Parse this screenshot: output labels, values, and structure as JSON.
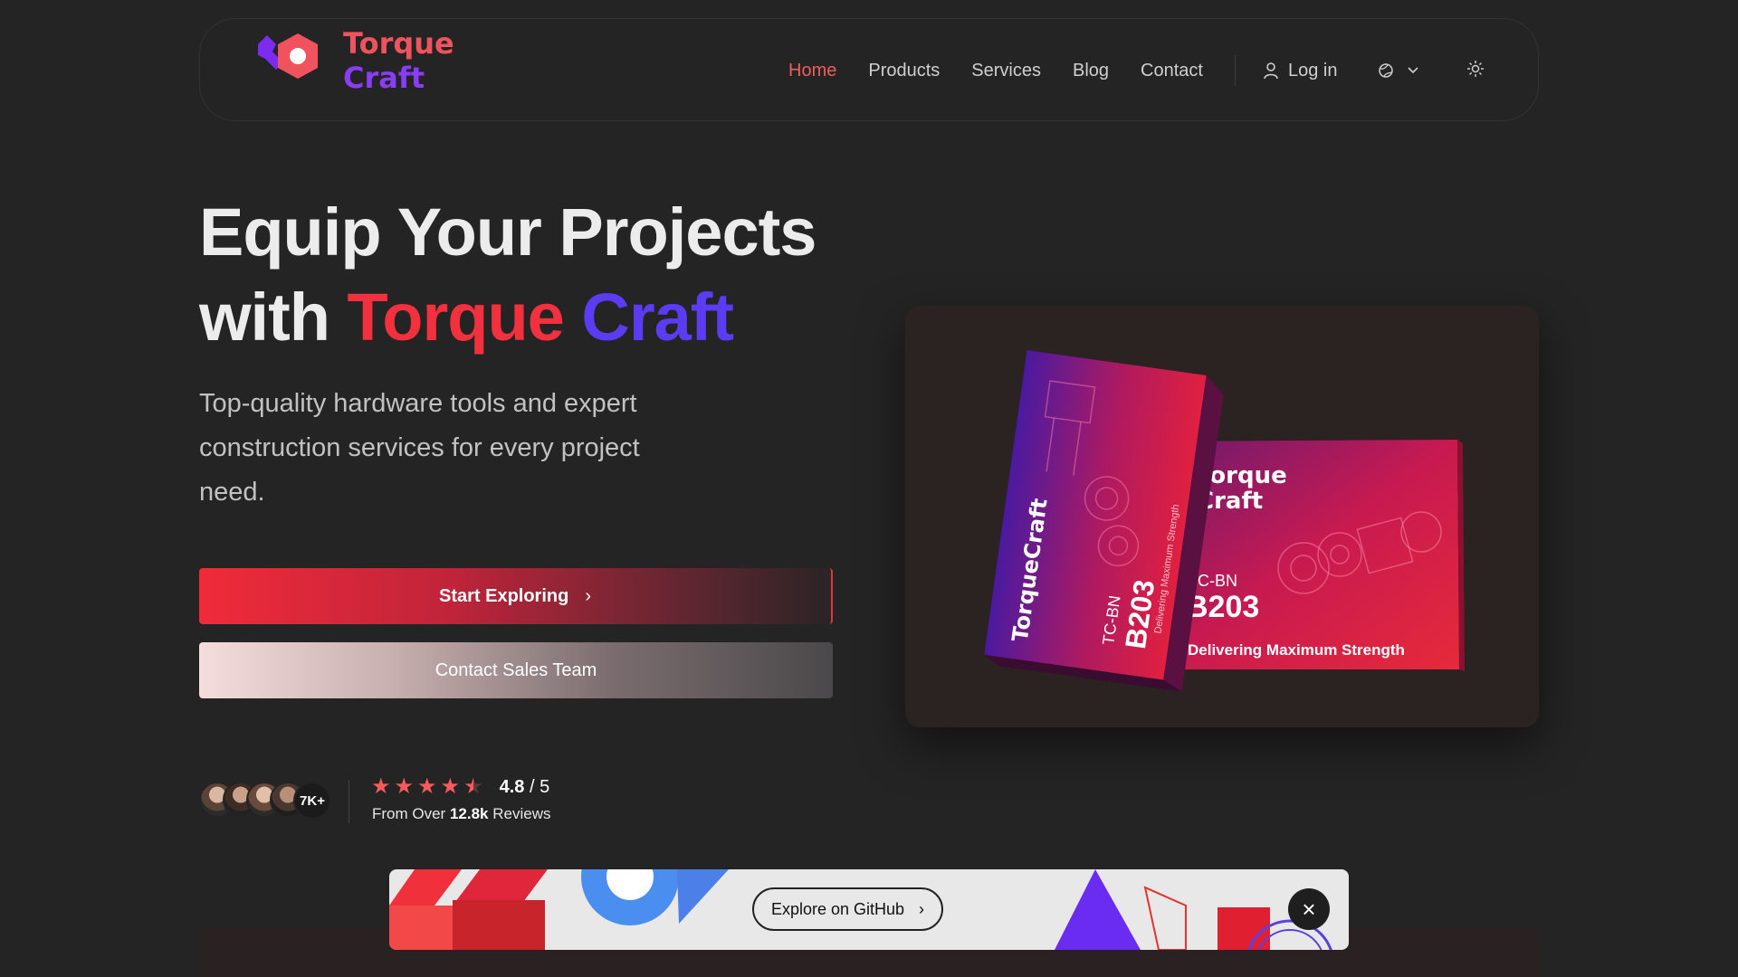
{
  "brand": {
    "line1": "Torque",
    "line2": "Craft"
  },
  "nav": {
    "items": [
      {
        "label": "Home",
        "active": true
      },
      {
        "label": "Products",
        "active": false
      },
      {
        "label": "Services",
        "active": false
      },
      {
        "label": "Blog",
        "active": false
      },
      {
        "label": "Contact",
        "active": false
      }
    ],
    "login_label": "Log in",
    "icons": {
      "login": "user-icon",
      "language": "globe-icon",
      "language_caret": "chevron-down-icon",
      "theme": "sun-icon"
    }
  },
  "hero": {
    "title_line1": "Equip Your Projects",
    "title_with": "with",
    "title_brand_red": "Torque",
    "title_brand_purple": "Craft",
    "subtitle": "Top-quality hardware tools and expert construction services for every project need.",
    "primary_button": "Start Exploring",
    "secondary_button": "Contact Sales Team"
  },
  "reviews": {
    "customer_count": "7K+",
    "rating": "4.8",
    "rating_max": "/ 5",
    "stars": 4.5,
    "from_prefix": "From Over",
    "count": "12.8k",
    "suffix": "Reviews"
  },
  "product_image": {
    "box_left_brand": "TorqueCraft",
    "box_left_code_small": "TC-BN",
    "box_left_code_big": "B203",
    "box_left_tagline": "Delivering Maximum Strength",
    "box_right_brand_line1": "Torque",
    "box_right_brand_line2": "Craft",
    "box_right_code_small": "TC-BN",
    "box_right_code_big": "B203",
    "box_right_tagline": "Delivering Maximum Strength"
  },
  "banner": {
    "button_label": "Explore on GitHub",
    "close_icon": "close-icon"
  },
  "colors": {
    "background": "#242424",
    "accent_red": "#f2303e",
    "accent_purple": "#5b3cf2",
    "nav_active": "#f25c5c"
  }
}
